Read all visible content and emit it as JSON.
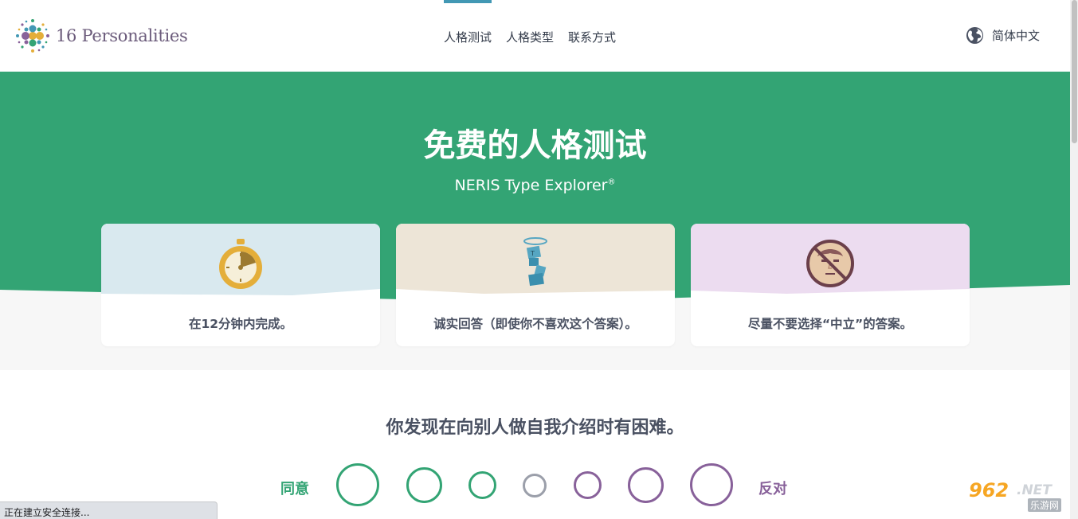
{
  "header": {
    "logo_text": "16 Personalities",
    "nav": [
      {
        "label": "人格测试",
        "active": true
      },
      {
        "label": "人格类型",
        "active": false
      },
      {
        "label": "联系方式",
        "active": false
      }
    ],
    "language": "简体中文"
  },
  "hero": {
    "title": "免费的人格测试",
    "subtitle": "NERIS Type Explorer",
    "subtitle_mark": "®",
    "cards": [
      {
        "text": "在12分钟内完成。",
        "icon": "stopwatch-icon",
        "bg": "#d9e9ef"
      },
      {
        "text": "诚实回答（即使你不喜欢这个答案）。",
        "icon": "honest-figure-icon",
        "bg": "#ede5d7"
      },
      {
        "text": "尽量不要选择“中立”的答案。",
        "icon": "no-neutral-face-icon",
        "bg": "#ecdcf0"
      }
    ]
  },
  "question": {
    "text": "你发现在向别人做自我介绍时有困难。",
    "agree_label": "同意",
    "disagree_label": "反对"
  },
  "status_bar": "正在建立安全连接...",
  "watermark": {
    "number": "962",
    "suffix": ".NET",
    "sub": "乐游网"
  },
  "colors": {
    "brand_green": "#33a474",
    "brand_purple": "#88619a",
    "neutral_gray": "#9b9faa",
    "accent_blue": "#4298b4"
  }
}
